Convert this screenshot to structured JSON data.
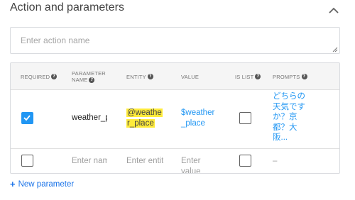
{
  "section": {
    "title": "Action and parameters"
  },
  "action_input": {
    "value": "",
    "placeholder": "Enter action name"
  },
  "table": {
    "headers": {
      "required": "REQUIRED",
      "parameter_name_1": "PARAMETER",
      "parameter_name_2": "NAME",
      "entity": "ENTITY",
      "value": "VALUE",
      "is_list": "IS LIST",
      "prompts": "PROMPTS"
    },
    "rows": [
      {
        "required": true,
        "parameter_name": "weather_place",
        "entity": "@weather_place",
        "entity_line1": "@weathe",
        "entity_line2": "r_place",
        "value_line1": "$weather",
        "value_line2": "_place",
        "is_list": false,
        "prompts_lines": [
          "どちらの",
          "天気です",
          "か？京",
          "都？大",
          "阪..."
        ]
      },
      {
        "required": false,
        "parameter_name_placeholder": "Enter name",
        "entity_placeholder": "Enter entity",
        "value_placeholder_line1": "Enter",
        "value_placeholder_line2": "value",
        "is_list": false,
        "prompts_placeholder": "–"
      }
    ]
  },
  "new_parameter": {
    "label": "New parameter"
  },
  "icons": {
    "collapse": "chevron-up-icon",
    "help": "help-circle-icon",
    "checkmark": "check-icon",
    "add": "plus-icon"
  },
  "colors": {
    "accent_blue": "#2196f3",
    "link_blue": "#1a73e8",
    "entity_highlight": "#ffeb3b",
    "header_bg": "#f5f5f5"
  }
}
